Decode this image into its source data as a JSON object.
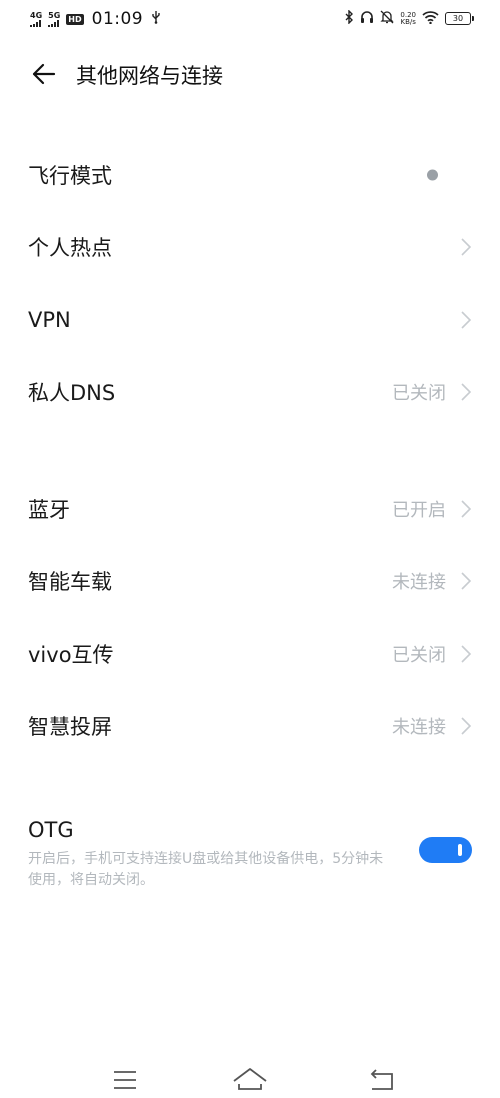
{
  "status_bar": {
    "signal1": "4G",
    "signal2": "5G",
    "hd": "HD",
    "hd_sub": "1\n2",
    "time": "01:09",
    "usb_icon": "usb-icon",
    "net_speed_value": "0.20",
    "net_speed_unit": "KB/s",
    "battery": "30"
  },
  "header": {
    "title": "其他网络与连接",
    "back_icon": "back-arrow-icon"
  },
  "items": [
    {
      "label": "飞行模式",
      "value": "",
      "control": "toggle-dot"
    },
    {
      "label": "个人热点",
      "value": "",
      "control": "chevron"
    },
    {
      "label": "VPN",
      "value": "",
      "control": "chevron"
    },
    {
      "label": "私人DNS",
      "value": "已关闭",
      "control": "chevron"
    },
    {
      "label": "蓝牙",
      "value": "已开启",
      "control": "chevron"
    },
    {
      "label": "智能车载",
      "value": "未连接",
      "control": "chevron"
    },
    {
      "label": "vivo互传",
      "value": "已关闭",
      "control": "chevron"
    },
    {
      "label": "智慧投屏",
      "value": "未连接",
      "control": "chevron"
    }
  ],
  "otg": {
    "label": "OTG",
    "description": "开启后，手机可支持连接U盘或给其他设备供电，5分钟未使用，将自动关闭。",
    "enabled": true
  },
  "navbar": {
    "menu_icon": "menu-icon",
    "home_icon": "home-icon",
    "back_icon": "back-icon"
  },
  "colors": {
    "accent": "#1f7cf5",
    "secondary_text": "#b3b8bd",
    "primary_text": "#1a1a1a"
  }
}
